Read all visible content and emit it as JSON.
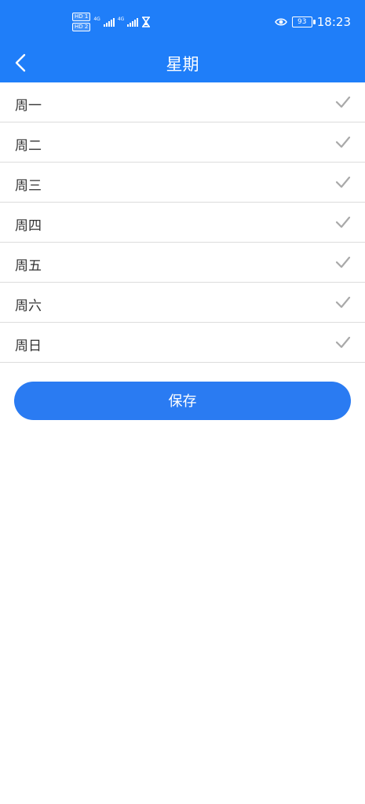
{
  "status_bar": {
    "sim1": "HD 1",
    "sim2": "HD 2",
    "net1": "4G",
    "net2": "4G",
    "battery": "93",
    "time": "18:23"
  },
  "header": {
    "title": "星期"
  },
  "weekdays": [
    {
      "label": "周一",
      "checked": true
    },
    {
      "label": "周二",
      "checked": true
    },
    {
      "label": "周三",
      "checked": true
    },
    {
      "label": "周四",
      "checked": true
    },
    {
      "label": "周五",
      "checked": true
    },
    {
      "label": "周六",
      "checked": true
    },
    {
      "label": "周日",
      "checked": true
    }
  ],
  "actions": {
    "save_label": "保存"
  },
  "colors": {
    "header_bg": "#1f7ef9",
    "button_bg": "#2a7bf2",
    "check": "#a9a9a9"
  }
}
